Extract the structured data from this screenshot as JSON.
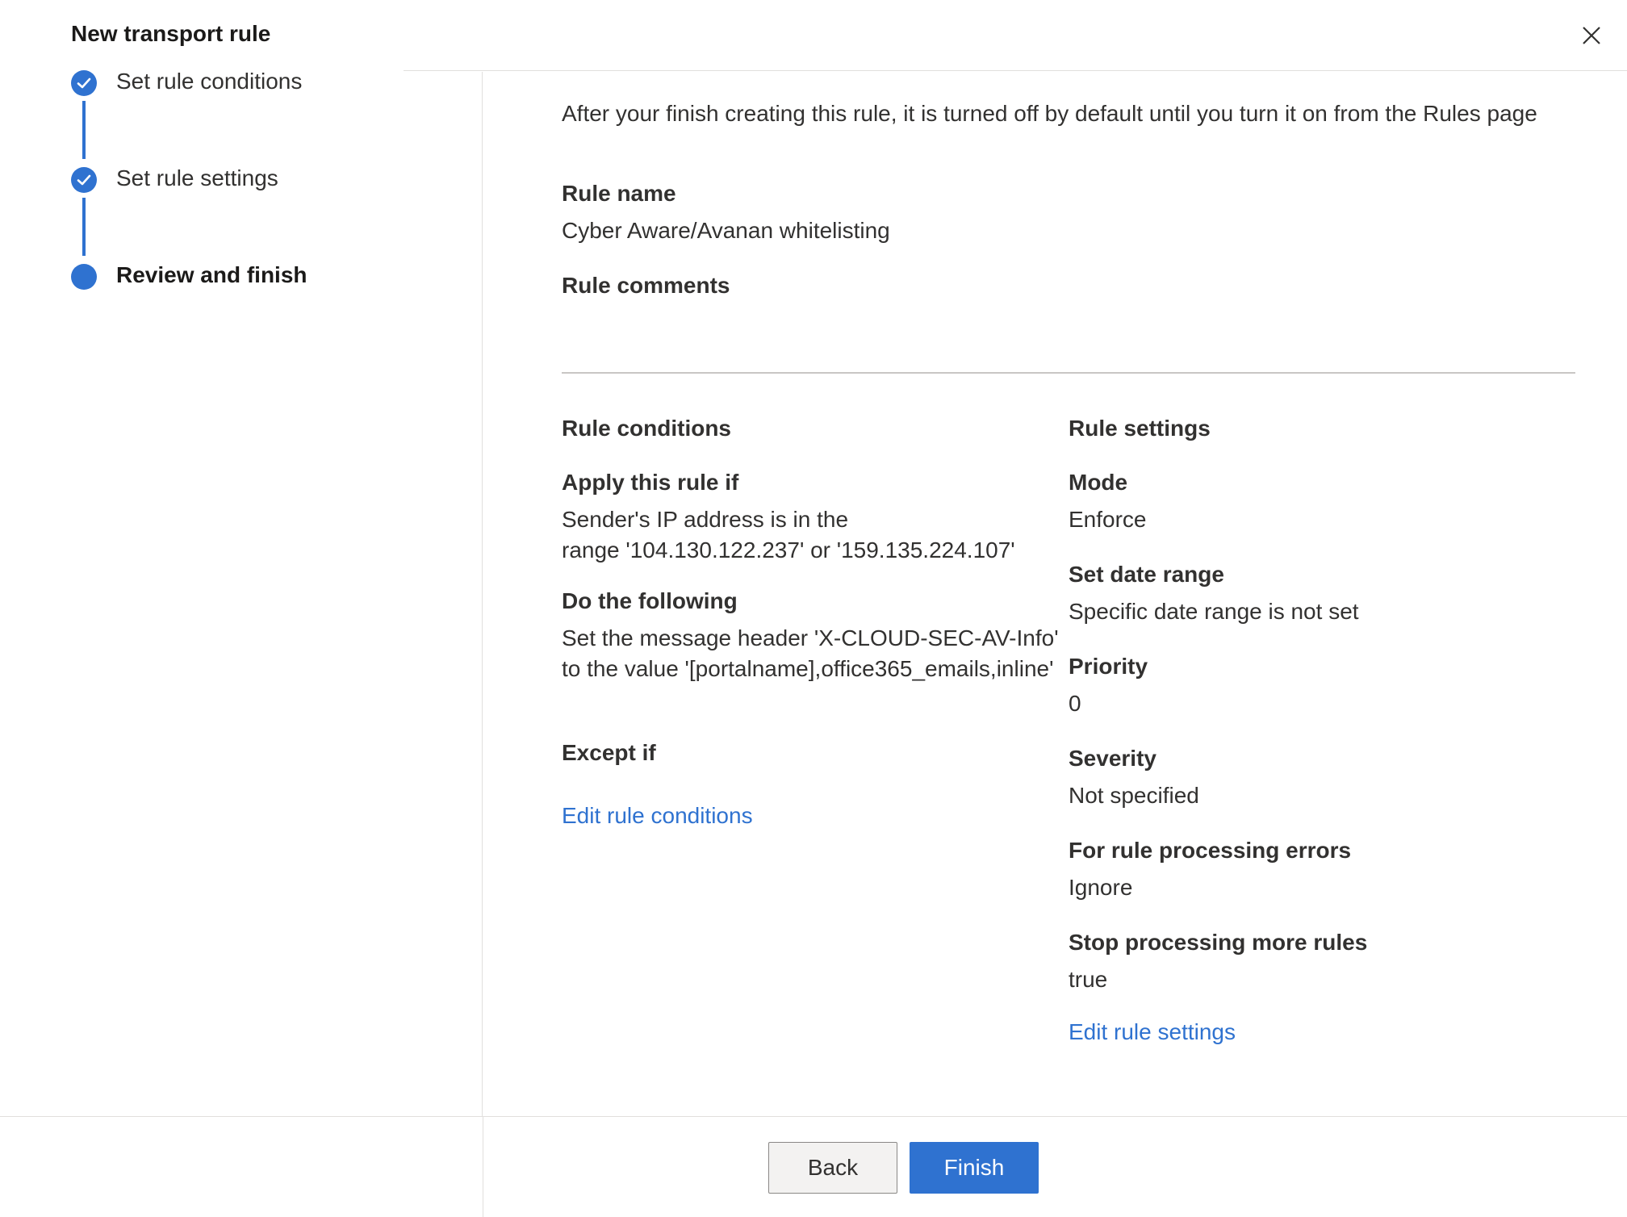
{
  "header": {
    "title": "New transport rule",
    "close_icon": "close-icon"
  },
  "steps": [
    {
      "label": "Set rule conditions",
      "state": "completed"
    },
    {
      "label": "Set rule settings",
      "state": "completed"
    },
    {
      "label": "Review and finish",
      "state": "current"
    }
  ],
  "colors": {
    "accent": "#2f72d0",
    "text": "#323130",
    "divider": "#c8c6c4"
  },
  "review": {
    "intro": "After your finish creating this rule, it is turned off by default until you turn it on from the Rules page",
    "rule_name_label": "Rule name",
    "rule_name_value": "Cyber Aware/Avanan whitelisting",
    "rule_comments_label": "Rule comments",
    "rule_comments_value": ""
  },
  "conditions": {
    "heading": "Rule conditions",
    "apply_label": "Apply this rule if",
    "apply_value_line1": "Sender's IP address is in the",
    "apply_value_line2": "range '104.130.122.237' or '159.135.224.107'",
    "do_label": "Do the following",
    "do_value_line1": "Set the message header  'X-CLOUD-SEC-AV-Info'",
    "do_value_line2": " to the value  '[portalname],office365_emails,inline'",
    "except_label": "Except if",
    "edit_link": "Edit rule conditions"
  },
  "settings": {
    "heading": "Rule settings",
    "mode_label": "Mode",
    "mode_value": "Enforce",
    "date_label": "Set date range",
    "date_value": "Specific date range is not set",
    "priority_label": "Priority",
    "priority_value": "0",
    "severity_label": "Severity",
    "severity_value": "Not specified",
    "errors_label": "For rule processing errors",
    "errors_value": "Ignore",
    "stop_label": "Stop processing more rules",
    "stop_value": "true",
    "edit_link": "Edit rule settings"
  },
  "footer": {
    "back_label": "Back",
    "finish_label": "Finish"
  }
}
